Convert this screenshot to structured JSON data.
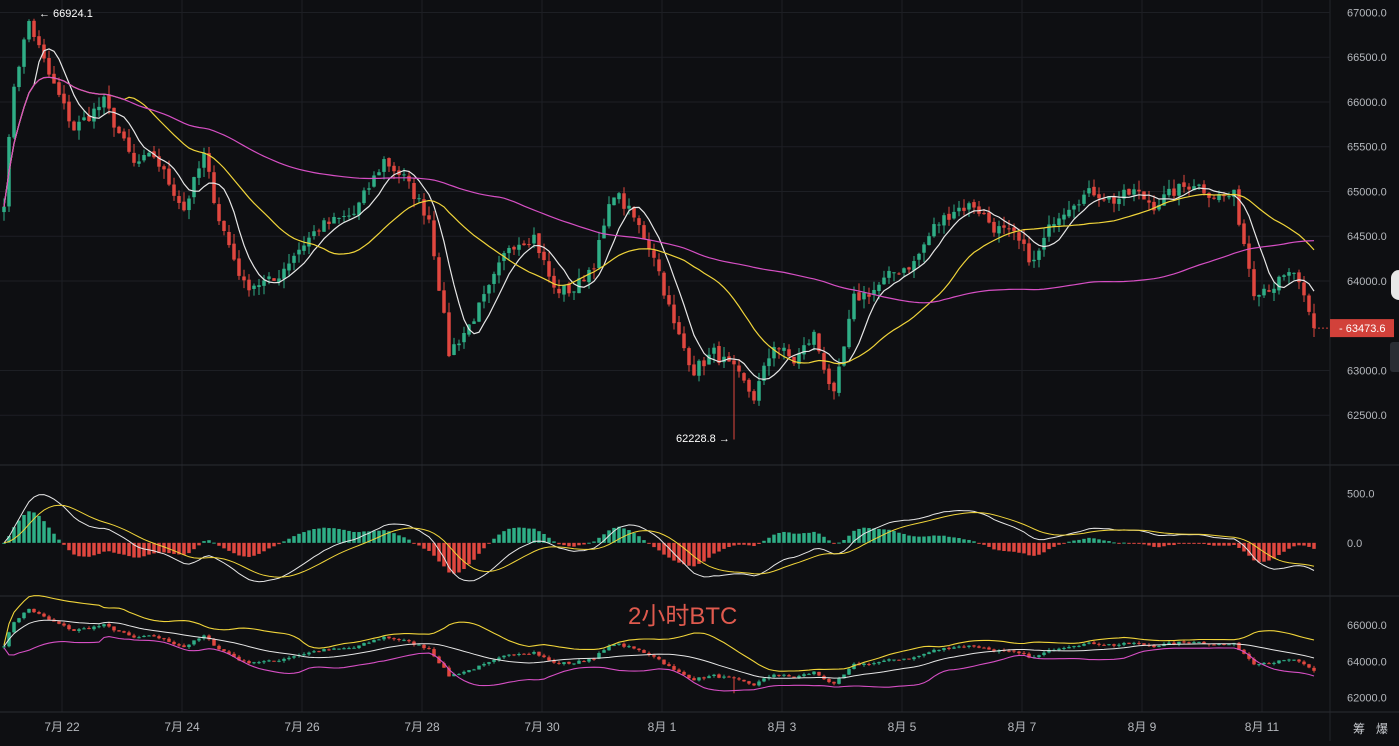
{
  "chart_data": {
    "type": "candlestick",
    "instrument_label": "2小时BTC",
    "x_tick_labels": [
      "7月 22",
      "7月 24",
      "7月 26",
      "7月 28",
      "7月 30",
      "8月 1",
      "8月 3",
      "8月 5",
      "8月 7",
      "8月 9",
      "8月 11"
    ],
    "price_axis": {
      "ticks": [
        "67000.0",
        "66500.0",
        "66000.0",
        "65500.0",
        "65000.0",
        "64500.0",
        "64000.0",
        "63000.0",
        "62500.0"
      ],
      "range": [
        62000,
        67050
      ]
    },
    "last_price": "63473.6",
    "high_marker": "66924.1",
    "low_marker": "62228.8",
    "anchors": [
      [
        0,
        64900
      ],
      [
        2,
        66200
      ],
      [
        5,
        66900
      ],
      [
        9,
        66300
      ],
      [
        14,
        65700
      ],
      [
        20,
        66000
      ],
      [
        26,
        65300
      ],
      [
        30,
        65400
      ],
      [
        36,
        64800
      ],
      [
        40,
        65400
      ],
      [
        43,
        64700
      ],
      [
        48,
        63950
      ],
      [
        54,
        64000
      ],
      [
        58,
        64300
      ],
      [
        63,
        64600
      ],
      [
        70,
        64750
      ],
      [
        76,
        65350
      ],
      [
        80,
        65150
      ],
      [
        85,
        64700
      ],
      [
        89,
        63200
      ],
      [
        93,
        63500
      ],
      [
        97,
        63900
      ],
      [
        101,
        64400
      ],
      [
        106,
        64500
      ],
      [
        110,
        63900
      ],
      [
        114,
        63900
      ],
      [
        118,
        64200
      ],
      [
        122,
        65000
      ],
      [
        126,
        64700
      ],
      [
        130,
        64300
      ],
      [
        134,
        63500
      ],
      [
        138,
        63000
      ],
      [
        142,
        63200
      ],
      [
        146,
        63000
      ],
      [
        150,
        62700
      ],
      [
        154,
        63300
      ],
      [
        158,
        63100
      ],
      [
        162,
        63400
      ],
      [
        166,
        62700
      ],
      [
        170,
        63800
      ],
      [
        174,
        63900
      ],
      [
        178,
        64100
      ],
      [
        182,
        64200
      ],
      [
        186,
        64600
      ],
      [
        190,
        64800
      ],
      [
        194,
        64850
      ],
      [
        198,
        64600
      ],
      [
        202,
        64500
      ],
      [
        206,
        64200
      ],
      [
        210,
        64700
      ],
      [
        214,
        64900
      ],
      [
        218,
        65000
      ],
      [
        222,
        64900
      ],
      [
        226,
        65000
      ],
      [
        230,
        64850
      ],
      [
        234,
        65000
      ],
      [
        238,
        65100
      ],
      [
        242,
        64950
      ],
      [
        246,
        64950
      ],
      [
        250,
        63900
      ],
      [
        254,
        63950
      ],
      [
        258,
        64100
      ],
      [
        262,
        63450
      ]
    ],
    "candle_count": 263,
    "moving_averages": [
      {
        "period": 7,
        "color": "#e6e6e6"
      },
      {
        "period": 25,
        "color": "#f0d43a"
      },
      {
        "period": 99,
        "color": "#d64fc4"
      }
    ],
    "macd": {
      "ticks": [
        "500.0",
        "0.0"
      ],
      "range": [
        -480,
        660
      ],
      "line_color": "#e6e6e6",
      "signal_color": "#f0d43a",
      "pos_color": "#2fae86",
      "neg_color": "#e0473f"
    },
    "bands": {
      "ticks": [
        "66000.0",
        "64000.0",
        "62000.0"
      ],
      "range": [
        61300,
        67400
      ],
      "upper_color": "#f0d43a",
      "middle_color": "#e6e6e6",
      "lower_color": "#d64fc4"
    },
    "colors": {
      "up": "#2fae86",
      "down": "#e0473f",
      "background": "#0e0f12",
      "grid": "#1d1f24",
      "axis_text": "#b5b8bd",
      "last_price_bg": "#d2413a"
    }
  },
  "controls": {
    "settings_glyph": "筹",
    "fullscreen_glyph": "爆"
  }
}
